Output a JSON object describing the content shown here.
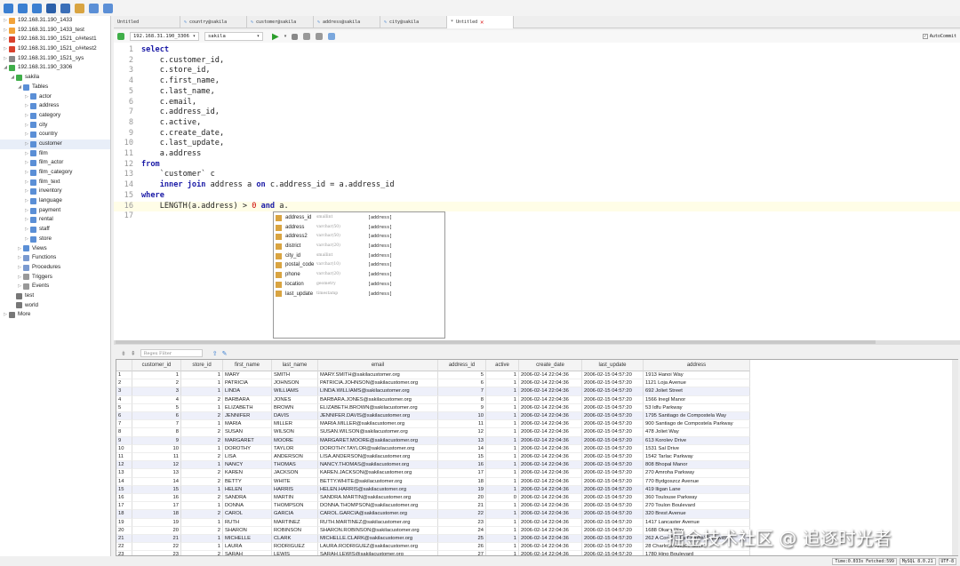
{
  "toolbar": {
    "icons": [
      "connect-icon",
      "new-query-icon",
      "open-icon",
      "save-icon",
      "binoculars-icon",
      "user-icon",
      "wand-icon",
      "clipboard-icon"
    ]
  },
  "sidebar": {
    "items": [
      {
        "label": "192.168.31.190_1433",
        "level": 0,
        "icon": "sqlserver",
        "color": "#f2a33a"
      },
      {
        "label": "192.168.31.190_1433_test",
        "level": 0,
        "icon": "sqlserver",
        "color": "#f2a33a"
      },
      {
        "label": "192.168.31.190_1521_c##test1",
        "level": 0,
        "icon": "oracle",
        "color": "#d9412e"
      },
      {
        "label": "192.168.31.190_1521_c##test2",
        "level": 0,
        "icon": "oracle",
        "color": "#d9412e"
      },
      {
        "label": "192.168.31.190_1521_sys",
        "level": 0,
        "icon": "server",
        "color": "#888888"
      },
      {
        "label": "192.168.31.190_3306",
        "level": 0,
        "icon": "mysql",
        "color": "#3fae49",
        "open": true
      },
      {
        "label": "sakila",
        "level": 1,
        "icon": "database",
        "color": "#3fae49",
        "open": true
      },
      {
        "label": "Tables",
        "level": 2,
        "icon": "table",
        "color": "#5b8fd6",
        "open": true
      },
      {
        "label": "actor",
        "level": 3,
        "icon": "table",
        "color": "#5b8fd6"
      },
      {
        "label": "address",
        "level": 3,
        "icon": "table",
        "color": "#5b8fd6"
      },
      {
        "label": "category",
        "level": 3,
        "icon": "table",
        "color": "#5b8fd6"
      },
      {
        "label": "city",
        "level": 3,
        "icon": "table",
        "color": "#5b8fd6"
      },
      {
        "label": "country",
        "level": 3,
        "icon": "table",
        "color": "#5b8fd6"
      },
      {
        "label": "customer",
        "level": 3,
        "icon": "table",
        "color": "#5b8fd6",
        "selected": true
      },
      {
        "label": "film",
        "level": 3,
        "icon": "table",
        "color": "#5b8fd6"
      },
      {
        "label": "film_actor",
        "level": 3,
        "icon": "table",
        "color": "#5b8fd6"
      },
      {
        "label": "film_category",
        "level": 3,
        "icon": "table",
        "color": "#5b8fd6"
      },
      {
        "label": "film_text",
        "level": 3,
        "icon": "table",
        "color": "#5b8fd6"
      },
      {
        "label": "inventory",
        "level": 3,
        "icon": "table",
        "color": "#5b8fd6"
      },
      {
        "label": "language",
        "level": 3,
        "icon": "table",
        "color": "#5b8fd6"
      },
      {
        "label": "payment",
        "level": 3,
        "icon": "table",
        "color": "#5b8fd6"
      },
      {
        "label": "rental",
        "level": 3,
        "icon": "table",
        "color": "#5b8fd6"
      },
      {
        "label": "staff",
        "level": 3,
        "icon": "table",
        "color": "#5b8fd6"
      },
      {
        "label": "store",
        "level": 3,
        "icon": "table",
        "color": "#5b8fd6"
      },
      {
        "label": "Views",
        "level": 2,
        "icon": "view",
        "color": "#5b8fd6"
      },
      {
        "label": "Functions",
        "level": 2,
        "icon": "function",
        "color": "#7a9ad0"
      },
      {
        "label": "Procedures",
        "level": 2,
        "icon": "procedure",
        "color": "#7a9ad0"
      },
      {
        "label": "Triggers",
        "level": 2,
        "icon": "trigger",
        "color": "#999999"
      },
      {
        "label": "Events",
        "level": 2,
        "icon": "event",
        "color": "#999999"
      },
      {
        "label": "test",
        "level": 1,
        "icon": "database",
        "color": "#777777",
        "noarrow": true
      },
      {
        "label": "world",
        "level": 1,
        "icon": "database",
        "color": "#777777",
        "noarrow": true
      },
      {
        "label": "More",
        "level": 0,
        "icon": "more",
        "color": "#777777"
      }
    ]
  },
  "tabs": [
    {
      "label": "Untitled"
    },
    {
      "label": "country@sakila"
    },
    {
      "label": "customer@sakila"
    },
    {
      "label": "address@sakila"
    },
    {
      "label": "city@sakila"
    },
    {
      "label": "* Untitled",
      "active": true
    }
  ],
  "editor_bar": {
    "connection": "192.168.31.190_3306",
    "database": "sakila",
    "autocommit_label": "AutoCommit",
    "autocommit": true
  },
  "editor": {
    "lines": [
      [
        {
          "t": "select",
          "k": "kw"
        }
      ],
      [
        {
          "t": "    c.customer_id,"
        }
      ],
      [
        {
          "t": "    c.store_id,"
        }
      ],
      [
        {
          "t": "    c.first_name,"
        }
      ],
      [
        {
          "t": "    c.last_name,"
        }
      ],
      [
        {
          "t": "    c.email,"
        }
      ],
      [
        {
          "t": "    c.address_id,"
        }
      ],
      [
        {
          "t": "    c.active,"
        }
      ],
      [
        {
          "t": "    c.create_date,"
        }
      ],
      [
        {
          "t": "    c.last_update,"
        }
      ],
      [
        {
          "t": "    a.address"
        }
      ],
      [
        {
          "t": "from",
          "k": "kw"
        }
      ],
      [
        {
          "t": "    `customer` c"
        }
      ],
      [
        {
          "t": "    "
        },
        {
          "t": "inner join",
          "k": "kw"
        },
        {
          "t": " address a "
        },
        {
          "t": "on",
          "k": "kw"
        },
        {
          "t": " c.address_id = a.address_id"
        }
      ],
      [
        {
          "t": "where",
          "k": "kw"
        }
      ],
      [
        {
          "t": "    LENGTH(a.address) > "
        },
        {
          "t": "0",
          "k": "num"
        },
        {
          "t": " "
        },
        {
          "t": "and",
          "k": "kw"
        },
        {
          "t": " a."
        }
      ],
      []
    ],
    "current_line": 16
  },
  "autocomplete": [
    {
      "name": "address_id",
      "type": "smallint",
      "table": "[address]"
    },
    {
      "name": "address",
      "type": "varchar(50)",
      "table": "[address]"
    },
    {
      "name": "address2",
      "type": "varchar(50)",
      "table": "[address]"
    },
    {
      "name": "district",
      "type": "varchar(20)",
      "table": "[address]"
    },
    {
      "name": "city_id",
      "type": "smallint",
      "table": "[address]"
    },
    {
      "name": "postal_code",
      "type": "varchar(10)",
      "table": "[address]"
    },
    {
      "name": "phone",
      "type": "varchar(20)",
      "table": "[address]"
    },
    {
      "name": "location",
      "type": "geometry",
      "table": "[address]"
    },
    {
      "name": "last_update",
      "type": "timestamp",
      "table": "[address]"
    }
  ],
  "results": {
    "filter_placeholder": "Regex Filter",
    "columns": [
      "",
      "customer_id",
      "store_id",
      "first_name",
      "last_name",
      "email",
      "address_id",
      "active",
      "create_date",
      "last_update",
      "address"
    ],
    "rows": [
      [
        "1",
        "1",
        "1",
        "MARY",
        "SMITH",
        "MARY.SMITH@sakilacustomer.org",
        "5",
        "1",
        "2006-02-14 22:04:36",
        "2006-02-15 04:57:20",
        "1913 Hanoi Way"
      ],
      [
        "2",
        "2",
        "1",
        "PATRICIA",
        "JOHNSON",
        "PATRICIA.JOHNSON@sakilacustomer.org",
        "6",
        "1",
        "2006-02-14 22:04:36",
        "2006-02-15 04:57:20",
        "1121 Loja Avenue"
      ],
      [
        "3",
        "3",
        "1",
        "LINDA",
        "WILLIAMS",
        "LINDA.WILLIAMS@sakilacustomer.org",
        "7",
        "1",
        "2006-02-14 22:04:36",
        "2006-02-15 04:57:20",
        "692 Joliet Street"
      ],
      [
        "4",
        "4",
        "2",
        "BARBARA",
        "JONES",
        "BARBARA.JONES@sakilacustomer.org",
        "8",
        "1",
        "2006-02-14 22:04:36",
        "2006-02-15 04:57:20",
        "1566 Inegl Manor"
      ],
      [
        "5",
        "5",
        "1",
        "ELIZABETH",
        "BROWN",
        "ELIZABETH.BROWN@sakilacustomer.org",
        "9",
        "1",
        "2006-02-14 22:04:36",
        "2006-02-15 04:57:20",
        "53 Idfu Parkway"
      ],
      [
        "6",
        "6",
        "2",
        "JENNIFER",
        "DAVIS",
        "JENNIFER.DAVIS@sakilacustomer.org",
        "10",
        "1",
        "2006-02-14 22:04:36",
        "2006-02-15 04:57:20",
        "1795 Santiago de Compostela Way"
      ],
      [
        "7",
        "7",
        "1",
        "MARIA",
        "MILLER",
        "MARIA.MILLER@sakilacustomer.org",
        "11",
        "1",
        "2006-02-14 22:04:36",
        "2006-02-15 04:57:20",
        "900 Santiago de Compostela Parkway"
      ],
      [
        "8",
        "8",
        "2",
        "SUSAN",
        "WILSON",
        "SUSAN.WILSON@sakilacustomer.org",
        "12",
        "1",
        "2006-02-14 22:04:36",
        "2006-02-15 04:57:20",
        "478 Joliet Way"
      ],
      [
        "9",
        "9",
        "2",
        "MARGARET",
        "MOORE",
        "MARGARET.MOORE@sakilacustomer.org",
        "13",
        "1",
        "2006-02-14 22:04:36",
        "2006-02-15 04:57:20",
        "613 Korolev Drive"
      ],
      [
        "10",
        "10",
        "1",
        "DOROTHY",
        "TAYLOR",
        "DOROTHY.TAYLOR@sakilacustomer.org",
        "14",
        "1",
        "2006-02-14 22:04:36",
        "2006-02-15 04:57:20",
        "1531 Sal Drive"
      ],
      [
        "11",
        "11",
        "2",
        "LISA",
        "ANDERSON",
        "LISA.ANDERSON@sakilacustomer.org",
        "15",
        "1",
        "2006-02-14 22:04:36",
        "2006-02-15 04:57:20",
        "1542 Tarlac Parkway"
      ],
      [
        "12",
        "12",
        "1",
        "NANCY",
        "THOMAS",
        "NANCY.THOMAS@sakilacustomer.org",
        "16",
        "1",
        "2006-02-14 22:04:36",
        "2006-02-15 04:57:20",
        "808 Bhopal Manor"
      ],
      [
        "13",
        "13",
        "2",
        "KAREN",
        "JACKSON",
        "KAREN.JACKSON@sakilacustomer.org",
        "17",
        "1",
        "2006-02-14 22:04:36",
        "2006-02-15 04:57:20",
        "270 Amroha Parkway"
      ],
      [
        "14",
        "14",
        "2",
        "BETTY",
        "WHITE",
        "BETTY.WHITE@sakilacustomer.org",
        "18",
        "1",
        "2006-02-14 22:04:36",
        "2006-02-15 04:57:20",
        "770 Bydgoszcz Avenue"
      ],
      [
        "15",
        "15",
        "1",
        "HELEN",
        "HARRIS",
        "HELEN.HARRIS@sakilacustomer.org",
        "19",
        "1",
        "2006-02-14 22:04:36",
        "2006-02-15 04:57:20",
        "419 Iligan Lane"
      ],
      [
        "16",
        "16",
        "2",
        "SANDRA",
        "MARTIN",
        "SANDRA.MARTIN@sakilacustomer.org",
        "20",
        "0",
        "2006-02-14 22:04:36",
        "2006-02-15 04:57:20",
        "360 Toulouse Parkway"
      ],
      [
        "17",
        "17",
        "1",
        "DONNA",
        "THOMPSON",
        "DONNA.THOMPSON@sakilacustomer.org",
        "21",
        "1",
        "2006-02-14 22:04:36",
        "2006-02-15 04:57:20",
        "270 Toulon Boulevard"
      ],
      [
        "18",
        "18",
        "2",
        "CAROL",
        "GARCIA",
        "CAROL.GARCIA@sakilacustomer.org",
        "22",
        "1",
        "2006-02-14 22:04:36",
        "2006-02-15 04:57:20",
        "320 Brest Avenue"
      ],
      [
        "19",
        "19",
        "1",
        "RUTH",
        "MARTINEZ",
        "RUTH.MARTINEZ@sakilacustomer.org",
        "23",
        "1",
        "2006-02-14 22:04:36",
        "2006-02-15 04:57:20",
        "1417 Lancaster Avenue"
      ],
      [
        "20",
        "20",
        "2",
        "SHARON",
        "ROBINSON",
        "SHARON.ROBINSON@sakilacustomer.org",
        "24",
        "1",
        "2006-02-14 22:04:36",
        "2006-02-15 04:57:20",
        "1688 Okara Way"
      ],
      [
        "21",
        "21",
        "1",
        "MICHELLE",
        "CLARK",
        "MICHELLE.CLARK@sakilacustomer.org",
        "25",
        "1",
        "2006-02-14 22:04:36",
        "2006-02-15 04:57:20",
        "262 A Coruña (La Coruña) Parkway"
      ],
      [
        "22",
        "22",
        "1",
        "LAURA",
        "RODRIGUEZ",
        "LAURA.RODRIGUEZ@sakilacustomer.org",
        "26",
        "1",
        "2006-02-14 22:04:36",
        "2006-02-15 04:57:20",
        "28 Charlotte Amalie Street"
      ],
      [
        "23",
        "23",
        "2",
        "SARAH",
        "LEWIS",
        "SARAH.LEWIS@sakilacustomer.org",
        "27",
        "1",
        "2006-02-14 22:04:36",
        "2006-02-15 04:57:20",
        "1780 Hino Boulevard"
      ]
    ]
  },
  "status": {
    "time": "Time:0.033s Fetched:599",
    "server": "MySQL 8.0.21",
    "encoding": "UTF-8"
  },
  "watermark": "掘金技术社区 @ 追逐时光者"
}
